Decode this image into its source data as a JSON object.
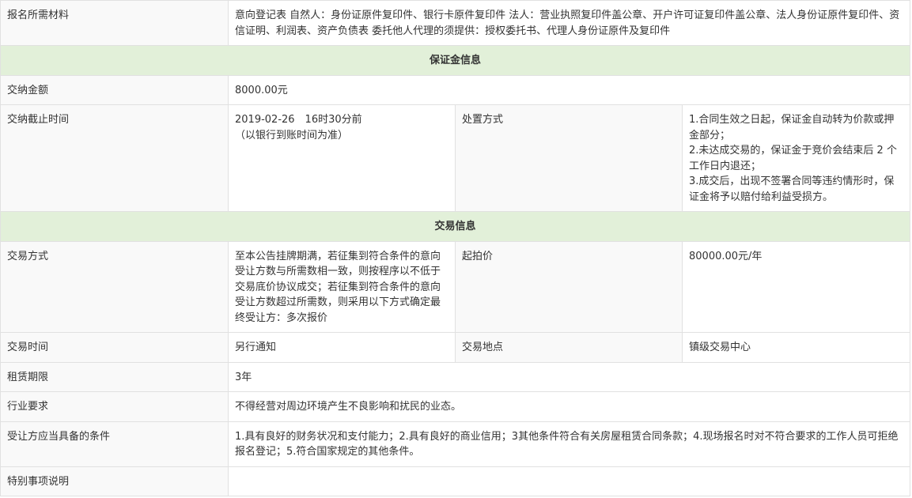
{
  "materials": {
    "label": "报名所需材料",
    "value": "意向登记表 自然人：身份证原件复印件、银行卡原件复印件 法人：营业执照复印件盖公章、开户许可证复印件盖公章、法人身份证原件复印件、资信证明、利润表、资产负债表 委托他人代理的须提供：授权委托书、代理人身份证原件及复印件"
  },
  "deposit_section": {
    "title": "保证金信息"
  },
  "deposit": {
    "amount_label": "交纳金额",
    "amount_value": "8000.00元",
    "deadline_label": "交纳截止时间",
    "deadline_value": "2019-02-26　16时30分前\n（以银行到账时间为准）",
    "disposal_label": "处置方式",
    "disposal_value": "1.合同生效之日起，保证金自动转为价款或押金部分；\n2.未达成交易的，保证金于竞价会结束后 2 个工作日内退还；\n3.成交后，出现不签署合同等违约情形时，保证金将予以赔付给利益受损方。"
  },
  "trade_section": {
    "title": "交易信息"
  },
  "trade": {
    "method_label": "交易方式",
    "method_value": "至本公告挂牌期满，若征集到符合条件的意向受让方数与所需数相一致，则按程序以不低于交易底价协议成交；若征集到符合条件的意向受让方数超过所需数，则采用以下方式确定最终受让方：多次报价",
    "start_price_label": "起拍价",
    "start_price_value": "80000.00元/年",
    "time_label": "交易时间",
    "time_value": "另行通知",
    "place_label": "交易地点",
    "place_value": "镇级交易中心",
    "lease_label": "租赁期限",
    "lease_value": "3年",
    "industry_label": "行业要求",
    "industry_value": "不得经营对周边环境产生不良影响和扰民的业态。",
    "conditions_label": "受让方应当具备的条件",
    "conditions_value": "1.具有良好的财务状况和支付能力；2.具有良好的商业信用；3其他条件符合有关房屋租赁合同条款；4.现场报名时对不符合要求的工作人员可拒绝报名登记；5.符合国家规定的其他条件。",
    "special_label": "特别事项说明",
    "special_value": ""
  }
}
